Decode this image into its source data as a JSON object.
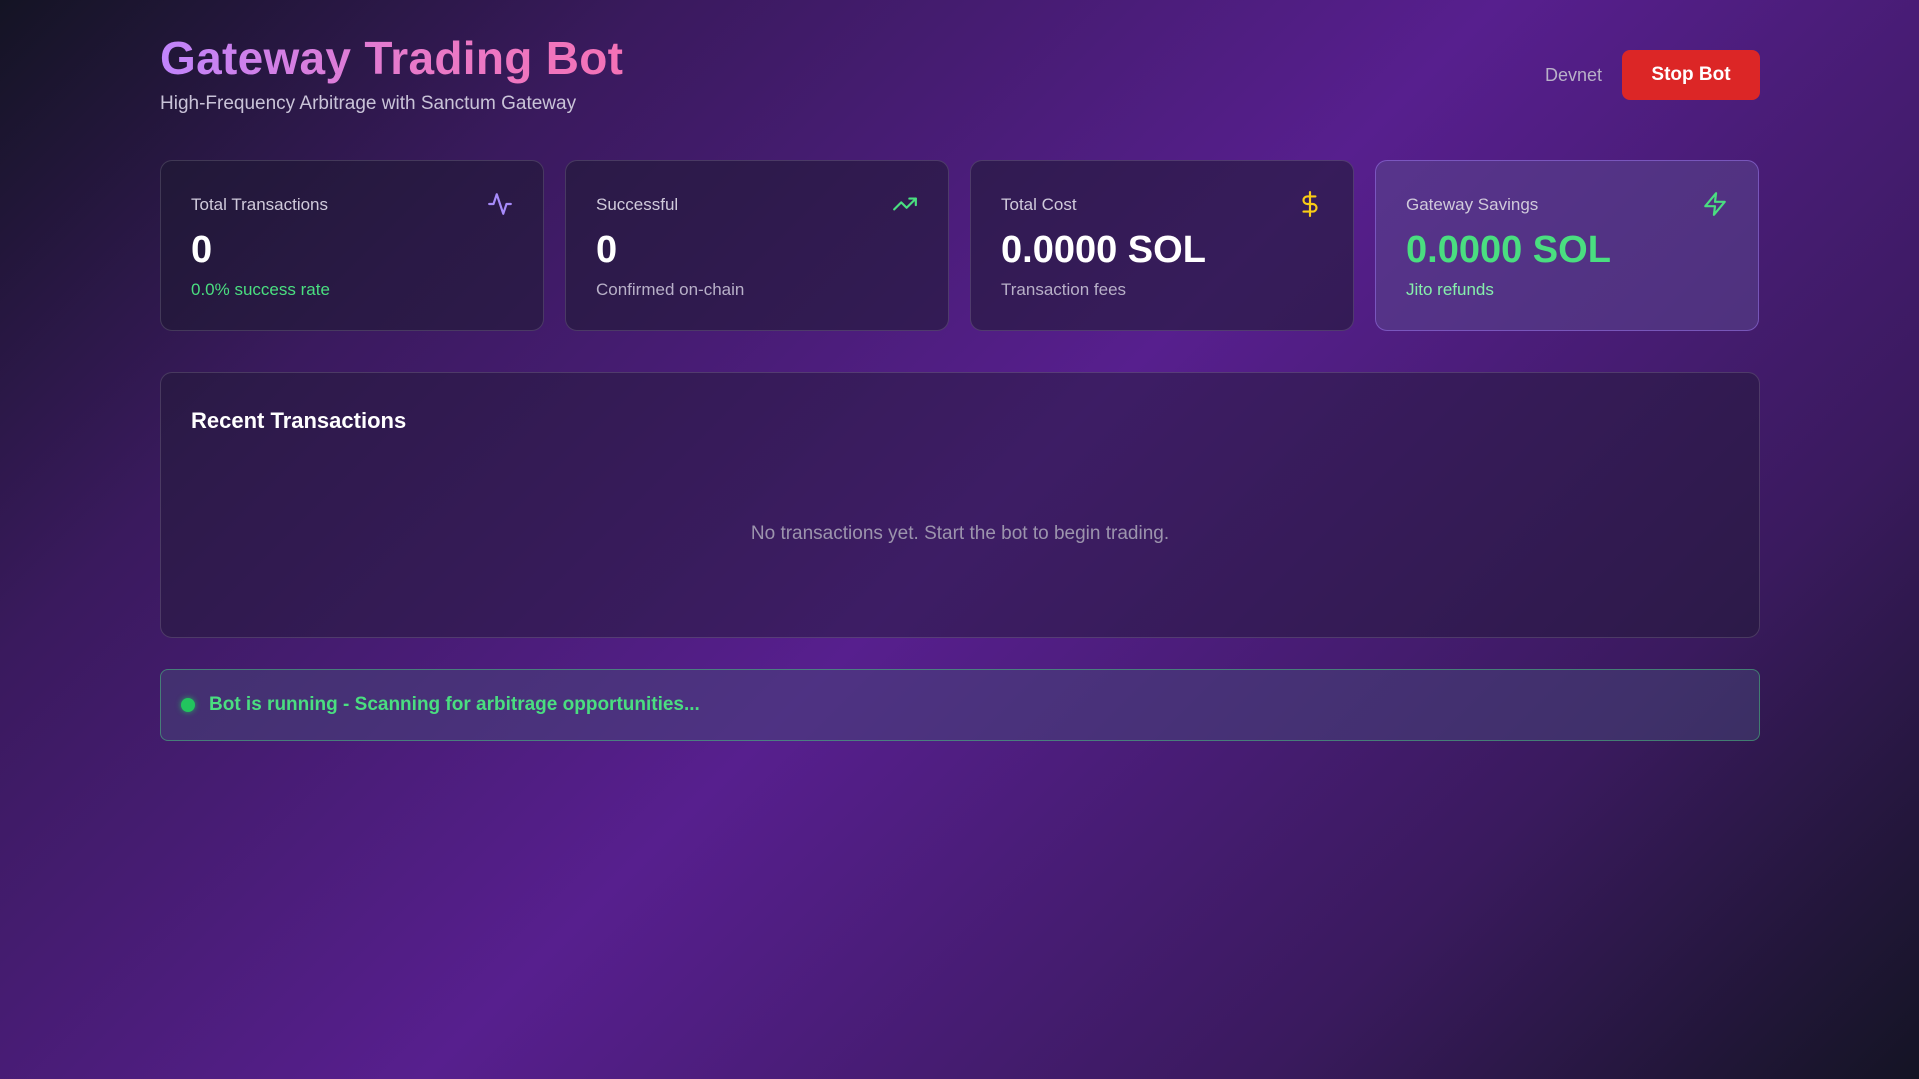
{
  "header": {
    "title": "Gateway Trading Bot",
    "subtitle": "High-Frequency Arbitrage with Sanctum Gateway",
    "network": "Devnet",
    "stop_button": "Stop Bot"
  },
  "stats": [
    {
      "label": "Total Transactions",
      "value": "0",
      "sub": "0.0% success rate",
      "icon": "activity-icon",
      "icon_color": "#a78bfa"
    },
    {
      "label": "Successful",
      "value": "0",
      "sub": "Confirmed on-chain",
      "icon": "trending-up-icon",
      "icon_color": "#4ade80"
    },
    {
      "label": "Total Cost",
      "value": "0.0000 SOL",
      "sub": "Transaction fees",
      "icon": "dollar-icon",
      "icon_color": "#facc15"
    },
    {
      "label": "Gateway Savings",
      "value": "0.0000 SOL",
      "sub": "Jito refunds",
      "icon": "lightning-icon",
      "icon_color": "#4ade80"
    }
  ],
  "transactions": {
    "title": "Recent Transactions",
    "empty_message": "No transactions yet. Start the bot to begin trading."
  },
  "status": {
    "message": "Bot is running - Scanning for arbitrage opportunities...",
    "color": "#4ade80"
  },
  "colors": {
    "accent_purple": "#c084fc",
    "accent_pink": "#f472b6",
    "danger": "#dc2626",
    "success": "#4ade80"
  }
}
